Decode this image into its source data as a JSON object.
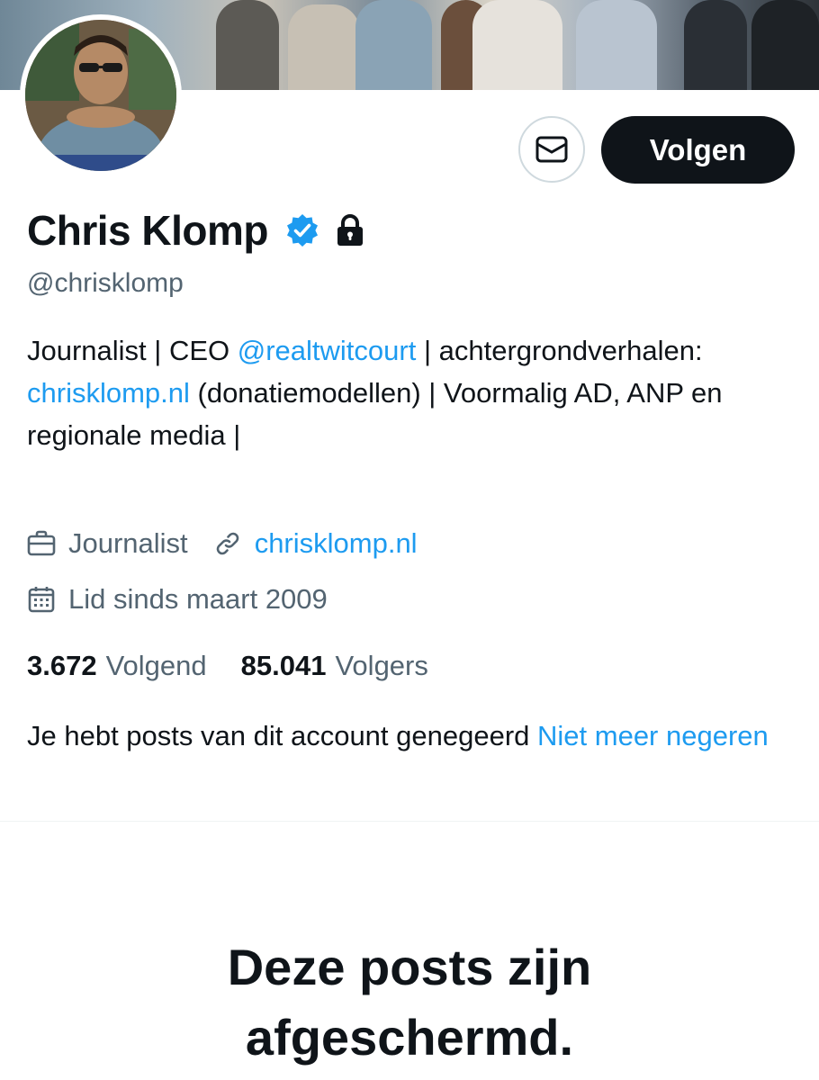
{
  "profile": {
    "display_name": "Chris Klomp",
    "handle": "@chrisklomp",
    "bio": {
      "part1": "Journalist | CEO ",
      "mention": "@realtwitcourt",
      "part2": " | achtergrondverhalen: ",
      "link": "chrisklomp.nl",
      "part3": " (donatiemodellen) | Voormalig AD, ANP en regionale media |"
    },
    "profession": "Journalist",
    "website": "chrisklomp.nl",
    "joined": "Lid sinds maart 2009",
    "following_count": "3.672",
    "following_label": "Volgend",
    "followers_count": "85.041",
    "followers_label": "Volgers"
  },
  "actions": {
    "follow_label": "Volgen",
    "message_icon": "envelope-icon"
  },
  "icons": {
    "verified": "verified-badge-icon",
    "lock": "lock-icon",
    "profession": "briefcase-icon",
    "website": "link-icon",
    "joined": "calendar-icon"
  },
  "notice": {
    "text": "Je hebt posts van dit account genegeerd ",
    "action": "Niet meer negeren"
  },
  "protected": {
    "title": "Deze posts zijn afgeschermd."
  },
  "colors": {
    "accent": "#1d9bf0",
    "text": "#0f1419",
    "secondary": "#536471",
    "button_dark": "#0f1419"
  }
}
